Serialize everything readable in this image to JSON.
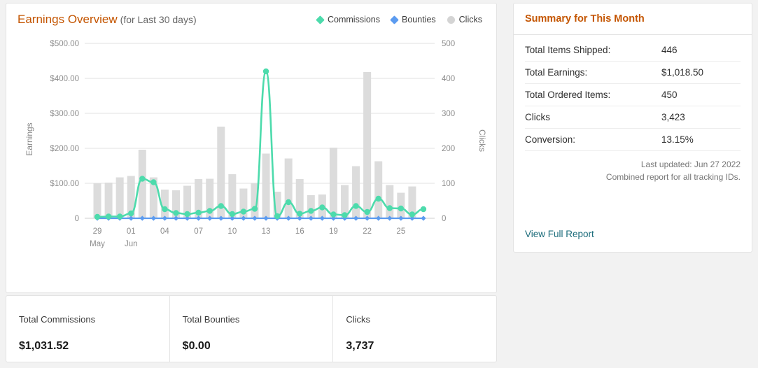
{
  "chart_panel": {
    "title": "Earnings Overview",
    "title_sub": "(for Last 30 days)",
    "legend": [
      {
        "label": "Commissions",
        "color": "#4ddbac",
        "marker": "diamond"
      },
      {
        "label": "Bounties",
        "color": "#5b9bf0",
        "marker": "diamond"
      },
      {
        "label": "Clicks",
        "color": "#d4d4d4",
        "marker": "circle"
      }
    ]
  },
  "chart_data": {
    "type": "bar",
    "title": "Earnings Overview (for Last 30 days)",
    "xlabel": "",
    "ylabel": "Earnings",
    "y2label": "Clicks",
    "ylim": [
      0,
      500
    ],
    "y2lim": [
      0,
      500
    ],
    "yticks": [
      "0",
      "$100.00",
      "$200.00",
      "$300.00",
      "$400.00",
      "$500.00"
    ],
    "y2ticks": [
      "0",
      "100",
      "200",
      "300",
      "400",
      "500"
    ],
    "grid": true,
    "legend_position": "top-right",
    "categories": [
      "29",
      "30",
      "31",
      "01",
      "02",
      "03",
      "04",
      "05",
      "06",
      "07",
      "08",
      "09",
      "10",
      "11",
      "12",
      "13",
      "14",
      "15",
      "16",
      "17",
      "18",
      "19",
      "20",
      "21",
      "22",
      "23",
      "24",
      "25",
      "26",
      "27"
    ],
    "xtick_labels": [
      {
        "index": 0,
        "day": "29",
        "month": "May"
      },
      {
        "index": 3,
        "day": "01",
        "month": "Jun"
      },
      {
        "index": 6,
        "day": "04",
        "month": ""
      },
      {
        "index": 9,
        "day": "07",
        "month": ""
      },
      {
        "index": 12,
        "day": "10",
        "month": ""
      },
      {
        "index": 15,
        "day": "13",
        "month": ""
      },
      {
        "index": 18,
        "day": "16",
        "month": ""
      },
      {
        "index": 21,
        "day": "19",
        "month": ""
      },
      {
        "index": 24,
        "day": "22",
        "month": ""
      },
      {
        "index": 27,
        "day": "25",
        "month": ""
      }
    ],
    "series": [
      {
        "name": "Clicks",
        "type": "bar",
        "axis": "right",
        "color": "#dcdcdc",
        "values": [
          100,
          102,
          117,
          121,
          196,
          117,
          82,
          80,
          93,
          112,
          113,
          262,
          126,
          85,
          101,
          185,
          76,
          171,
          112,
          66,
          68,
          202,
          95,
          149,
          418,
          163,
          95,
          73,
          91,
          0
        ]
      },
      {
        "name": "Commissions",
        "type": "line",
        "axis": "left",
        "color": "#4ddbac",
        "values": [
          4,
          5,
          5,
          14,
          113,
          103,
          26,
          15,
          12,
          16,
          21,
          35,
          12,
          19,
          27,
          420,
          6,
          46,
          13,
          21,
          31,
          11,
          9,
          35,
          18,
          56,
          29,
          28,
          11,
          26
        ]
      },
      {
        "name": "Bounties",
        "type": "line",
        "axis": "left",
        "color": "#5b9bf0",
        "values": [
          0,
          0,
          0,
          0,
          0,
          0,
          0,
          0,
          0,
          0,
          0,
          0,
          0,
          0,
          0,
          0,
          0,
          0,
          0,
          0,
          0,
          0,
          0,
          0,
          0,
          0,
          0,
          0,
          0,
          0
        ]
      }
    ]
  },
  "summary": {
    "title": "Summary for This Month",
    "rows": [
      {
        "key": "Total Items Shipped:",
        "value": "446"
      },
      {
        "key": "Total Earnings:",
        "value": "$1,018.50"
      },
      {
        "key": "Total Ordered Items:",
        "value": "450"
      },
      {
        "key": "Clicks",
        "value": "3,423"
      },
      {
        "key": "Conversion:",
        "value": "13.15%"
      }
    ],
    "last_updated": "Last updated: Jun 27 2022",
    "note": "Combined report for all tracking IDs.",
    "link": "View Full Report"
  },
  "stats": [
    {
      "label": "Total Commissions",
      "value": "$1,031.52"
    },
    {
      "label": "Total Bounties",
      "value": "$0.00"
    },
    {
      "label": "Clicks",
      "value": "3,737"
    }
  ]
}
